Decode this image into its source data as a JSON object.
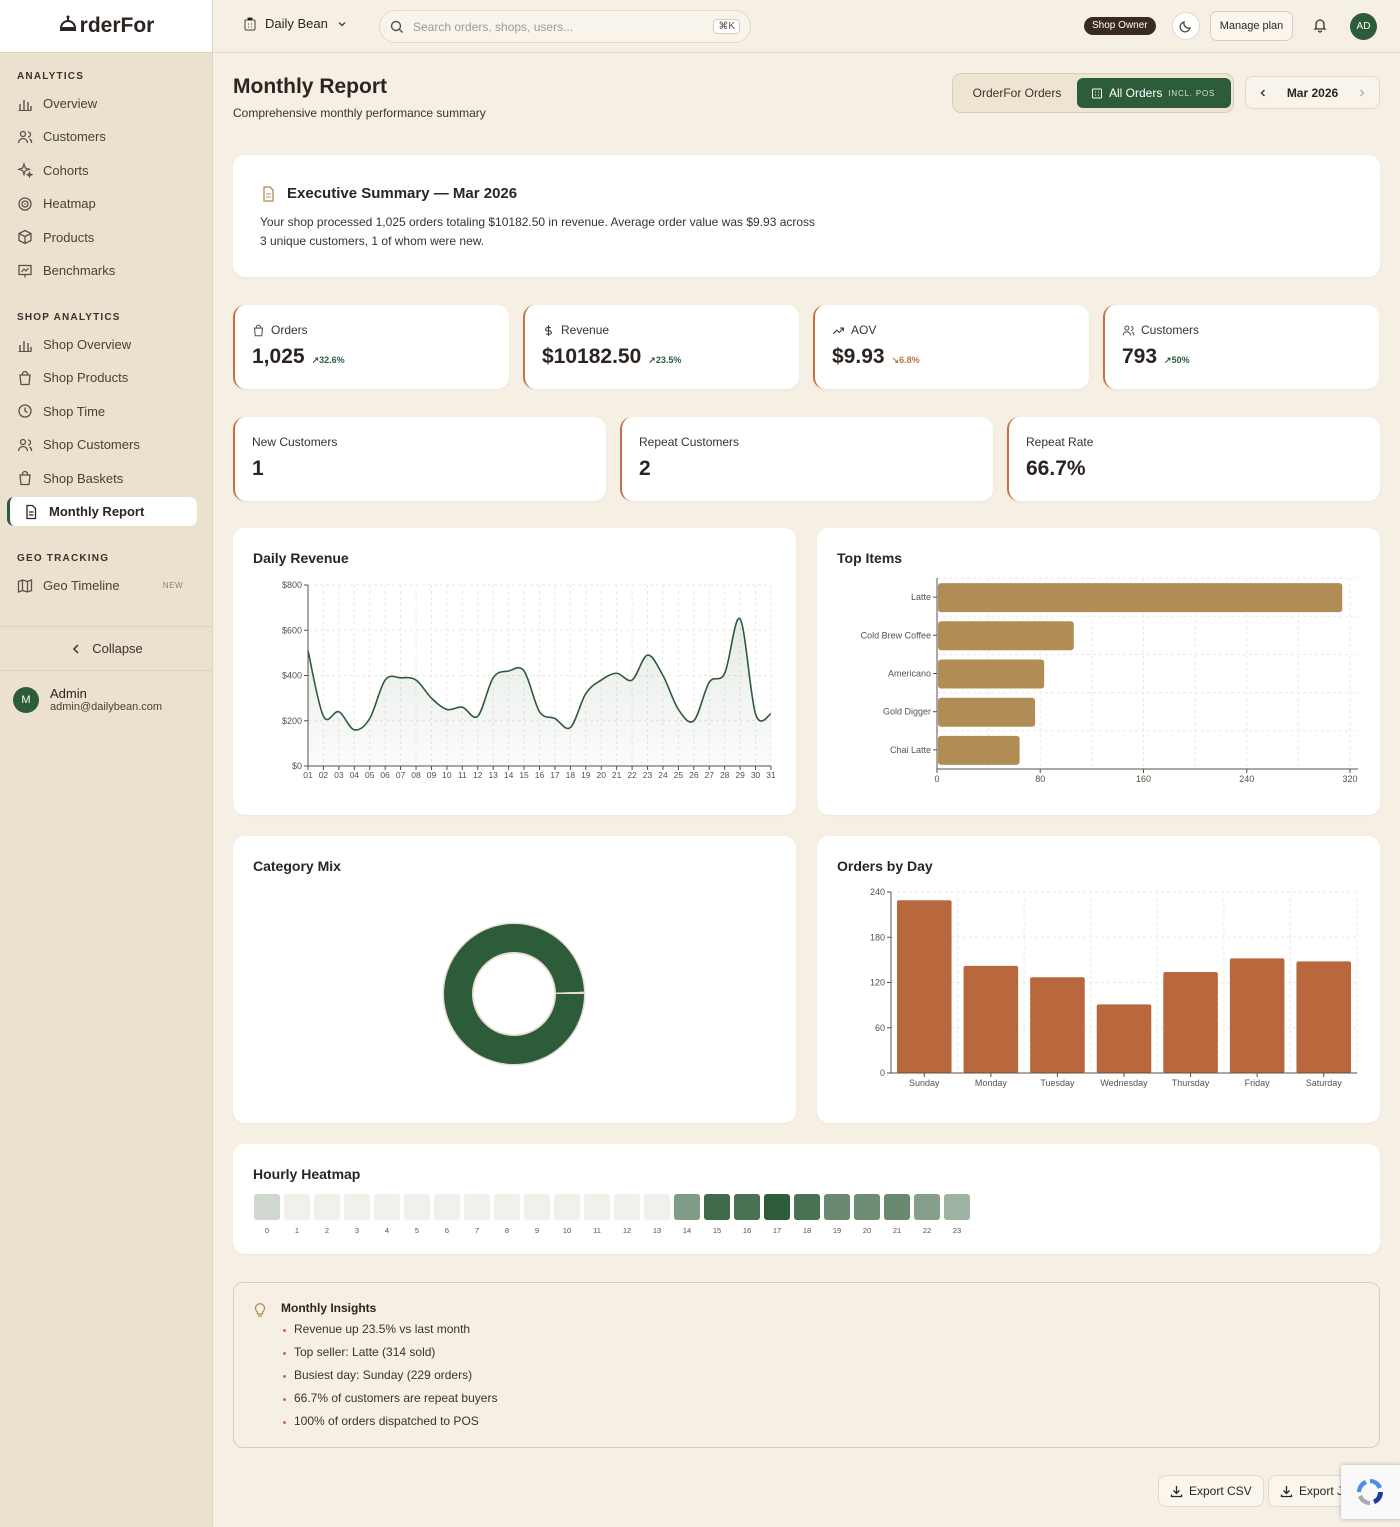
{
  "app": {
    "logo_text": "rderFor"
  },
  "sidebar": {
    "sections": [
      {
        "title": "ANALYTICS",
        "items": [
          {
            "label": "Overview",
            "icon": "bar-chart-icon"
          },
          {
            "label": "Customers",
            "icon": "users-icon"
          },
          {
            "label": "Cohorts",
            "icon": "sparkles-icon"
          },
          {
            "label": "Heatmap",
            "icon": "target-icon"
          },
          {
            "label": "Products",
            "icon": "box-icon"
          },
          {
            "label": "Benchmarks",
            "icon": "presentation-icon"
          }
        ]
      },
      {
        "title": "SHOP ANALYTICS",
        "items": [
          {
            "label": "Shop Overview",
            "icon": "bar-chart-icon"
          },
          {
            "label": "Shop Products",
            "icon": "shopping-bag-icon"
          },
          {
            "label": "Shop Time",
            "icon": "clock-icon"
          },
          {
            "label": "Shop Customers",
            "icon": "users-icon"
          },
          {
            "label": "Shop Baskets",
            "icon": "shopping-bag-icon"
          },
          {
            "label": "Monthly Report",
            "icon": "file-text-icon",
            "active": true
          }
        ]
      },
      {
        "title": "GEO TRACKING",
        "items": [
          {
            "label": "Geo Timeline",
            "icon": "map-icon",
            "badge": "NEW"
          }
        ]
      }
    ],
    "collapse_label": "Collapse",
    "user": {
      "initial": "M",
      "name": "Admin",
      "email": "admin@dailybean.com"
    }
  },
  "topbar": {
    "shop_name": "Daily Bean",
    "search_placeholder": "Search orders, shops, users...",
    "search_shortcut": "⌘K",
    "role_badge": "Shop Owner",
    "manage_plan": "Manage plan",
    "avatar": "AD"
  },
  "page": {
    "title": "Monthly Report",
    "subtitle": "Comprehensive monthly performance summary",
    "toggle": {
      "option_a": "OrderFor Orders",
      "option_b": "All Orders",
      "option_b_tag": "INCL. POS"
    },
    "month": "Mar 2026"
  },
  "executive": {
    "title": "Executive Summary — Mar 2026",
    "text": "Your shop processed 1,025 orders totaling $10182.50 in revenue. Average order value was $9.93 across 3 unique customers, 1 of whom were new."
  },
  "kpis": [
    {
      "label": "Orders",
      "value": "1,025",
      "change": "32.6%",
      "direction": "up",
      "icon": "shopping-bag-icon"
    },
    {
      "label": "Revenue",
      "value": "$10182.50",
      "change": "23.5%",
      "direction": "up",
      "icon": "dollar-icon"
    },
    {
      "label": "AOV",
      "value": "$9.93",
      "change": "6.8%",
      "direction": "down",
      "icon": "trending-up-icon"
    },
    {
      "label": "Customers",
      "value": "793",
      "change": "50%",
      "direction": "up",
      "icon": "users-icon"
    }
  ],
  "kpis2": [
    {
      "label": "New Customers",
      "value": "1"
    },
    {
      "label": "Repeat Customers",
      "value": "2"
    },
    {
      "label": "Repeat Rate",
      "value": "66.7%"
    }
  ],
  "panels": {
    "daily_revenue": "Daily Revenue",
    "top_items": "Top Items",
    "category_mix": "Category Mix",
    "orders_by_day": "Orders by Day",
    "hourly_heatmap": "Hourly Heatmap"
  },
  "chart_data": [
    {
      "type": "area",
      "title": "Daily Revenue",
      "x": [
        "01",
        "02",
        "03",
        "04",
        "05",
        "06",
        "07",
        "08",
        "09",
        "10",
        "11",
        "12",
        "13",
        "14",
        "15",
        "16",
        "17",
        "18",
        "19",
        "20",
        "21",
        "22",
        "23",
        "24",
        "25",
        "26",
        "27",
        "28",
        "29",
        "30",
        "31"
      ],
      "y": [
        510,
        220,
        240,
        160,
        210,
        380,
        390,
        380,
        300,
        250,
        260,
        220,
        390,
        420,
        420,
        240,
        210,
        170,
        320,
        380,
        410,
        380,
        490,
        400,
        250,
        200,
        370,
        410,
        650,
        230,
        230
      ],
      "ylim": [
        0,
        800
      ],
      "yticks": [
        "$0",
        "$200",
        "$400",
        "$600",
        "$800"
      ],
      "color": "#2d5c3a",
      "grid": true
    },
    {
      "type": "bar",
      "orientation": "horizontal",
      "title": "Top Items",
      "categories": [
        "Latte",
        "Cold Brew Coffee",
        "Americano",
        "Gold Digger",
        "Chai Latte"
      ],
      "values": [
        314,
        106,
        83,
        76,
        64
      ],
      "xlim": [
        0,
        320
      ],
      "xticks": [
        0,
        80,
        160,
        240,
        320
      ],
      "color": "#b18d55"
    },
    {
      "type": "pie",
      "title": "Category Mix",
      "slices": [
        {
          "value": 99.5,
          "color": "#2d5c3a"
        },
        {
          "value": 0.5,
          "color": "#e6ddd0"
        }
      ]
    },
    {
      "type": "bar",
      "title": "Orders by Day",
      "categories": [
        "Sunday",
        "Monday",
        "Tuesday",
        "Wednesday",
        "Thursday",
        "Friday",
        "Saturday"
      ],
      "values": [
        229,
        142,
        127,
        91,
        134,
        152,
        148
      ],
      "ylim": [
        0,
        240
      ],
      "yticks": [
        0,
        60,
        120,
        180,
        240
      ],
      "color": "#b8683c"
    },
    {
      "type": "heatmap",
      "title": "Hourly Heatmap",
      "hours": [
        "0",
        "1",
        "2",
        "3",
        "4",
        "5",
        "6",
        "7",
        "8",
        "9",
        "10",
        "11",
        "12",
        "13",
        "14",
        "15",
        "16",
        "17",
        "18",
        "19",
        "20",
        "21",
        "22",
        "23"
      ],
      "intensity": [
        0.12,
        0.02,
        0.02,
        0.02,
        0.02,
        0.02,
        0.02,
        0.02,
        0.02,
        0.02,
        0.02,
        0.02,
        0.02,
        0.02,
        0.55,
        0.9,
        0.85,
        1.0,
        0.85,
        0.68,
        0.65,
        0.68,
        0.52,
        0.38
      ]
    }
  ],
  "insights": {
    "title": "Monthly Insights",
    "items": [
      "Revenue up 23.5% vs last month",
      "Top seller: Latte (314 sold)",
      "Busiest day: Sunday (229 orders)",
      "66.7% of customers are repeat buyers",
      "100% of orders dispatched to POS"
    ]
  },
  "exports": {
    "csv": "Export CSV",
    "other": "Export J"
  },
  "colors": {
    "accent": "#2d5c3a",
    "secondary": "#c47245",
    "background": "#f5efe4"
  }
}
